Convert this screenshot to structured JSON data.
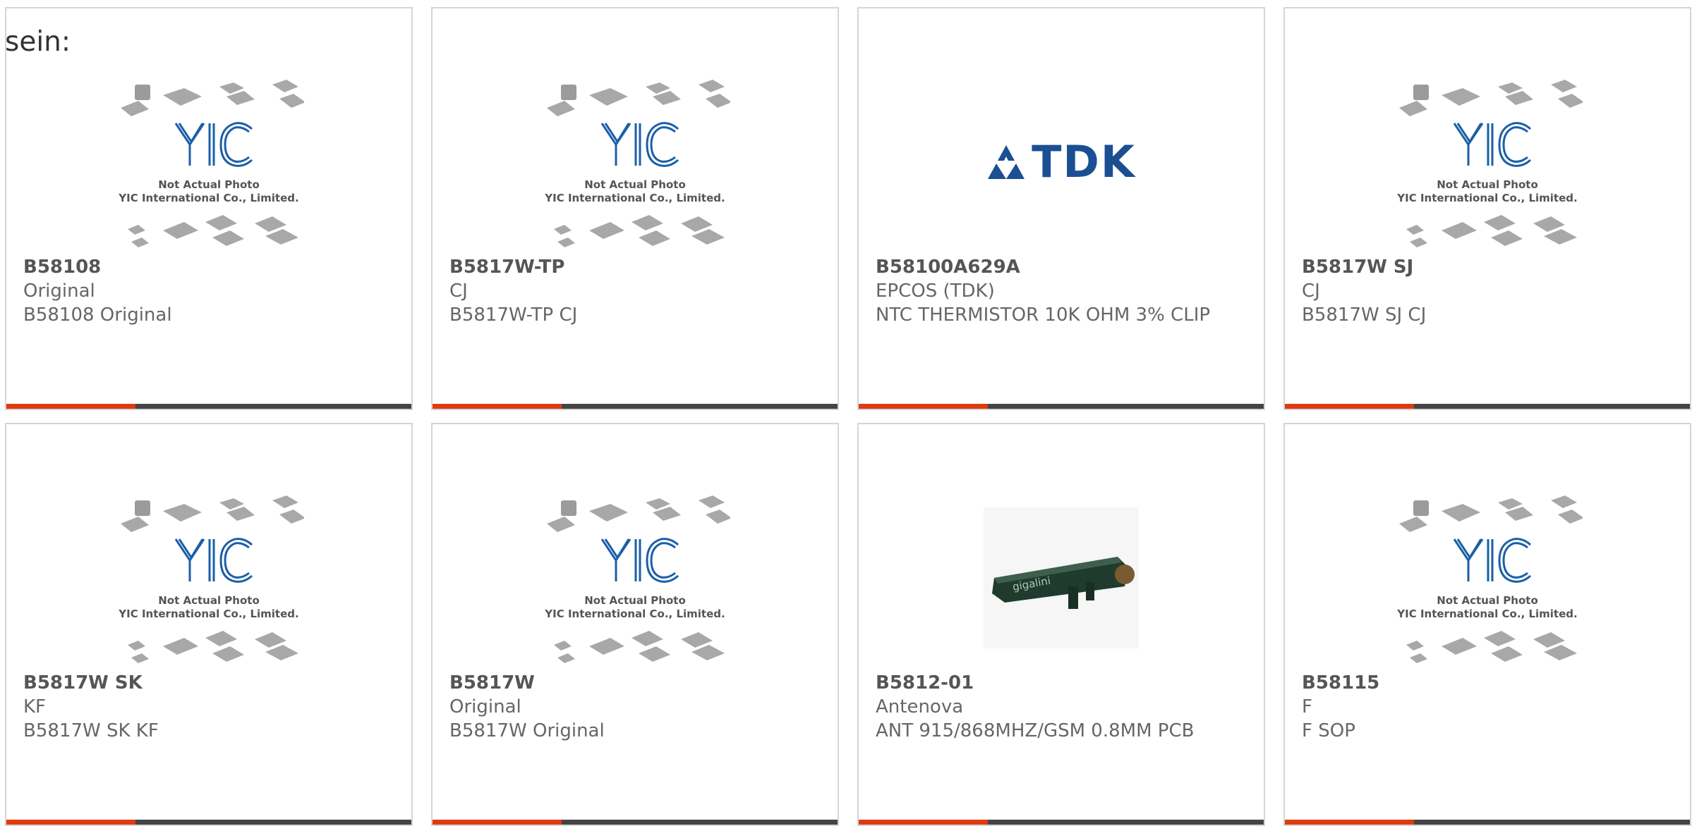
{
  "page_label": "sein:",
  "colors": {
    "accent": "#e03a10",
    "bar": "#444444",
    "logo": "#1a5fa8",
    "tdk": "#1b4f93"
  },
  "placeholder": {
    "caption_line1": "Not Actual Photo",
    "caption_line2": "YIC International Co., Limited."
  },
  "tdk_logo": {
    "text": "TDK"
  },
  "cards": [
    {
      "part": "B58108",
      "manufacturer": "Original",
      "description": "B58108 Original",
      "image": "placeholder"
    },
    {
      "part": "B5817W-TP",
      "manufacturer": "CJ",
      "description": "B5817W-TP CJ",
      "image": "placeholder"
    },
    {
      "part": "B58100A629A",
      "manufacturer": "EPCOS (TDK)",
      "description": "NTC THERMISTOR 10K OHM 3% CLIP",
      "image": "tdk-logo"
    },
    {
      "part": "B5817W SJ",
      "manufacturer": "CJ",
      "description": "B5817W SJ CJ",
      "image": "placeholder"
    },
    {
      "part": "B5817W SK",
      "manufacturer": "KF",
      "description": "B5817W SK KF",
      "image": "placeholder"
    },
    {
      "part": "B5817W",
      "manufacturer": "Original",
      "description": "B5817W Original",
      "image": "placeholder"
    },
    {
      "part": "B5812-01",
      "manufacturer": "Antenova",
      "description": "ANT 915/868MHZ/GSM 0.8MM PCB",
      "image": "antenna-photo"
    },
    {
      "part": "B58115",
      "manufacturer": "F",
      "description": "F SOP",
      "image": "placeholder"
    }
  ]
}
